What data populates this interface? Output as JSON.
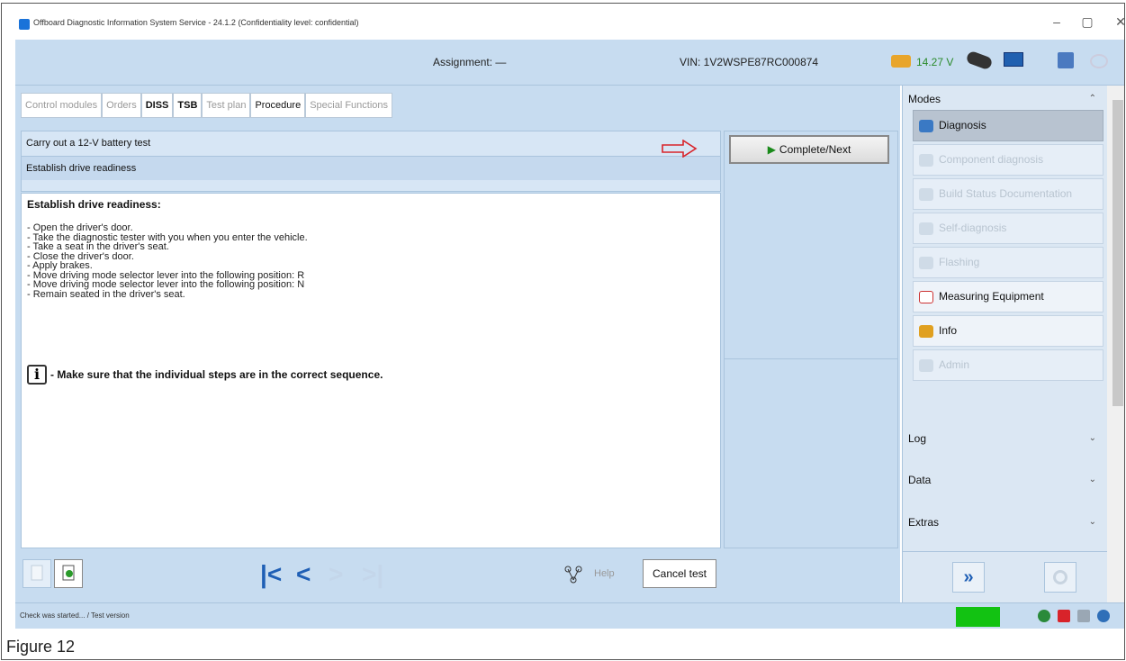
{
  "window": {
    "title": "Offboard Diagnostic Information System Service - 24.1.2 (Confidentiality level: confidential)",
    "minimize": "–",
    "maximize": "▢",
    "close": "✕"
  },
  "toolbar": {
    "assignment": "Assignment: —",
    "vin": "VIN:  1V2WSPE87RC000874",
    "voltage": "14.27 V"
  },
  "tabs": [
    {
      "label": "Control modules"
    },
    {
      "label": "Orders"
    },
    {
      "label": "DISS"
    },
    {
      "label": "TSB"
    },
    {
      "label": "Test plan"
    },
    {
      "label": "Procedure"
    },
    {
      "label": "Special Functions"
    }
  ],
  "steps": [
    {
      "label": "Carry out a 12-V battery test"
    },
    {
      "label": "Establish drive readiness"
    }
  ],
  "complete_next_label": "Complete/Next",
  "content": {
    "heading": "Establish drive readiness:",
    "lines": [
      "- Open the driver's door.",
      "- Take the diagnostic tester with you when you enter the vehicle.",
      "- Take a seat in the driver's seat.",
      "- Close the driver's door.",
      "- Apply brakes.",
      "- Move driving mode selector lever into the following position: R",
      "- Move driving mode selector lever into the following position: N",
      "- Remain seated in the driver's seat."
    ],
    "notice": "- Make sure that the individual steps are in the correct sequence."
  },
  "bottom": {
    "help": "Help",
    "cancel": "Cancel test"
  },
  "side": {
    "modes_header": "Modes",
    "modes": [
      {
        "label": "Diagnosis"
      },
      {
        "label": "Component diagnosis"
      },
      {
        "label": "Build Status Documentation"
      },
      {
        "label": "Self-diagnosis"
      },
      {
        "label": "Flashing"
      },
      {
        "label": "Measuring Equipment"
      },
      {
        "label": "Info"
      },
      {
        "label": "Admin"
      }
    ],
    "log_header": "Log",
    "data_header": "Data",
    "extras_header": "Extras",
    "collapse_glyph": "⌃",
    "expand_glyph": "⌄"
  },
  "status": {
    "message": "Check was started... / Test version"
  },
  "caption": "Figure 12"
}
